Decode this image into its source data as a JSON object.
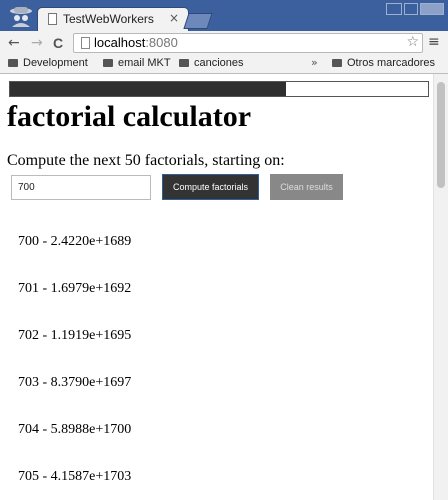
{
  "browser": {
    "tab_title": "TestWebWorkers",
    "tab_close": "×",
    "url_host": "localhost",
    "url_port": ":8080",
    "nav": {
      "back": "←",
      "forward": "→",
      "reload": "C"
    },
    "star": "☆",
    "menu": "≡"
  },
  "bookmarks": {
    "items": [
      "Development",
      "email MKT",
      "canciones"
    ],
    "overflow": "»",
    "other": "Otros marcadores"
  },
  "page": {
    "progress_fraction": 0.66,
    "heading": "factorial calculator",
    "prompt": "Compute the next 50 factorials, starting on:",
    "start_value": "700",
    "compute_label": "Compute factorials",
    "clean_label": "Clean results",
    "results": [
      "700 - 2.4220e+1689",
      "701 - 1.6979e+1692",
      "702 - 1.1919e+1695",
      "703 - 8.3790e+1697",
      "704 - 5.8988e+1700",
      "705 - 4.1587e+1703"
    ]
  }
}
